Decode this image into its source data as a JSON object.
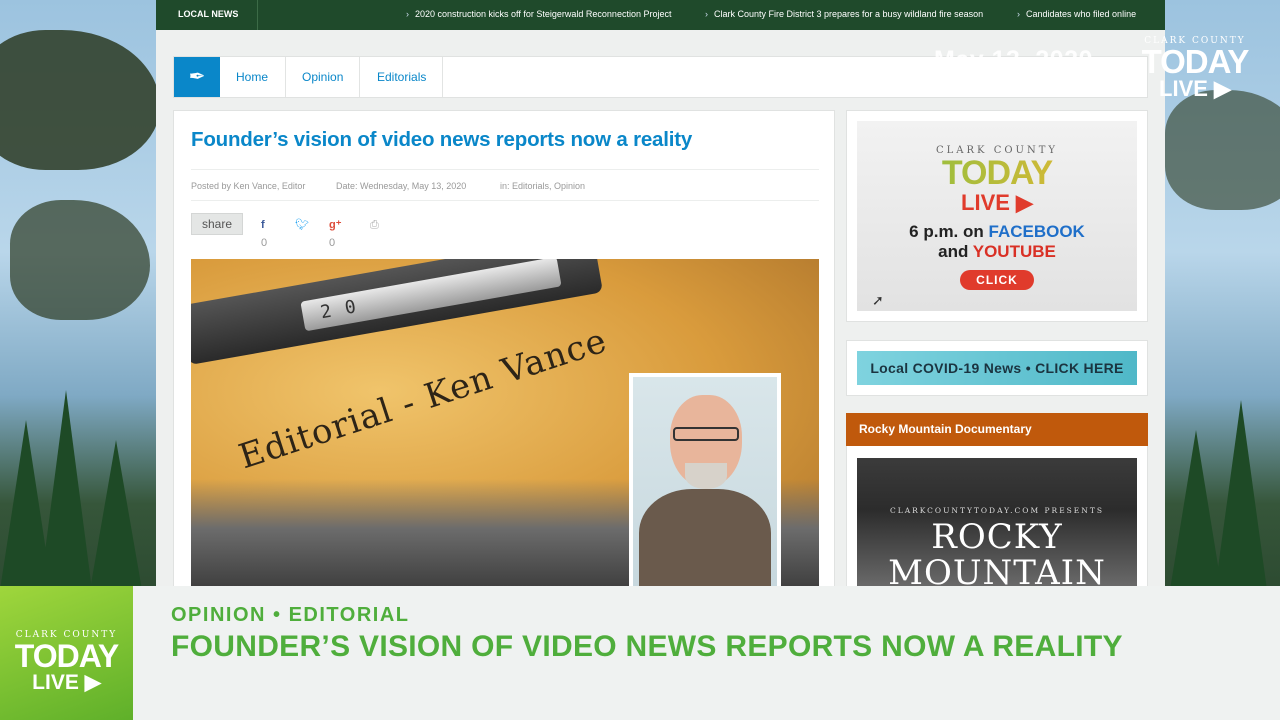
{
  "ticker": {
    "label": "LOCAL NEWS",
    "items": [
      "2020 construction kicks off for Steigerwald Reconnection Project",
      "Clark County Fire District 3 prepares for a busy wildland fire season",
      "Candidates who filed online"
    ]
  },
  "breadcrumb": {
    "home": "Home",
    "opinion": "Opinion",
    "editorials": "Editorials"
  },
  "article": {
    "title": "Founder’s vision of video news reports now a reality",
    "posted_by": "Posted by Ken Vance, Editor",
    "date": "Date: Wednesday, May 13, 2020",
    "in": "in: Editorials, Opinion",
    "share_label": "share",
    "facebook_count": "0",
    "gplus_count": "0",
    "hero": {
      "ruler_digits": "20",
      "typed_text": "Editorial - Ken Vance"
    }
  },
  "sidebar": {
    "live_ad": {
      "brand": "CLARK COUNTY",
      "today": "TODAY",
      "live": "LIVE",
      "when_prefix": "6 p.m. on ",
      "facebook": "FACEBOOK",
      "and": "and ",
      "youtube": "YOUTUBE",
      "click": "CLICK"
    },
    "covid_banner": "Local COVID-19 News • CLICK HERE",
    "doc_heading": "Rocky Mountain Documentary",
    "doc": {
      "presents": "CLARKCOUNTYTODAY.COM PRESENTS",
      "title": "ROCKY MOUNTAIN"
    }
  },
  "overlay": {
    "date": "May 13, 2020",
    "logo_brand": "CLARK COUNTY",
    "logo_today": "TODAY",
    "logo_live": "LIVE"
  },
  "lower_third": {
    "logo_brand": "CLARK COUNTY",
    "logo_today": "TODAY",
    "logo_live": "LIVE",
    "kicker": "OPINION • EDITORIAL",
    "headline": "FOUNDER’S VISION OF VIDEO NEWS REPORTS NOW A REALITY"
  },
  "colors": {
    "link_blue": "#0a87c9",
    "ticker_green": "#1f4a2b",
    "lower_green": "#4fae3c",
    "doc_orange": "#c0590c"
  },
  "icons": {
    "breadcrumb": "feather-icon",
    "share_facebook": "facebook-icon",
    "share_twitter": "twitter-icon",
    "share_gplus": "google-plus-icon",
    "share_print": "print-icon",
    "live_play": "play-circle-icon"
  }
}
